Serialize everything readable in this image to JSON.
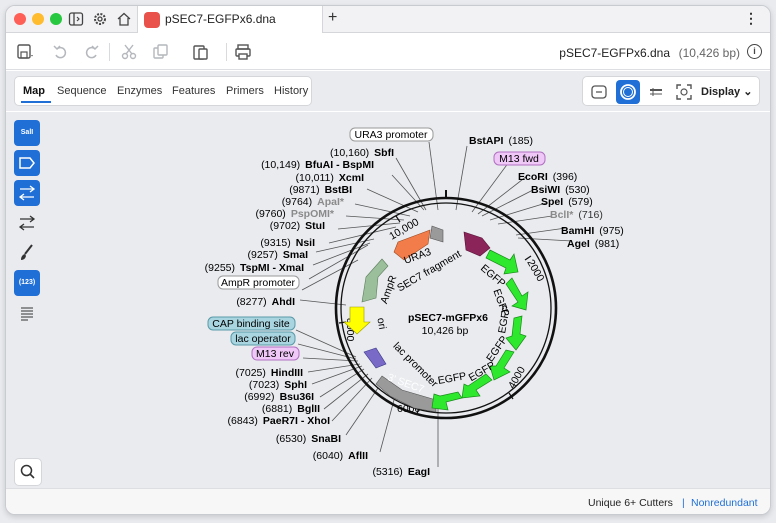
{
  "tab": {
    "title": "pSEC7-EGFPx6.dna"
  },
  "toolbar": {
    "file_name": "pSEC7-EGFPx6.dna",
    "file_length": "(10,426 bp)",
    "info_label": "i"
  },
  "view_tabs": [
    "Map",
    "Sequence",
    "Enzymes",
    "Features",
    "Primers",
    "History"
  ],
  "display_label": "Display",
  "left_tools": {
    "enzyme_label": "SalI",
    "numbers_label": "(123)"
  },
  "map": {
    "name": "pSEC7-mGFPx6",
    "length": "10,426 bp",
    "ticks": [
      "2000",
      "4000",
      "6000",
      "8000",
      "10,000"
    ],
    "features": [
      "URA3",
      "SEC7 fragment",
      "AmpR",
      "ori",
      "lac promoter",
      "3' SEC7",
      "EGFP",
      "EGFP",
      "EGFP",
      "EGFP",
      "EGFP",
      "EGFP"
    ]
  },
  "boxed_labels": {
    "ura3_promoter": "URA3 promoter",
    "m13_fwd": "M13 fwd",
    "ampr_promoter": "AmpR promoter",
    "cap_binding": "CAP binding site",
    "lac_operator": "lac operator",
    "m13_rev": "M13 rev"
  },
  "sites_right": [
    {
      "pos": "(185)",
      "name": "BstAPI"
    },
    {
      "pos": "(396)",
      "name": "EcoRI"
    },
    {
      "pos": "(530)",
      "name": "BsiWI"
    },
    {
      "pos": "(579)",
      "name": "SpeI"
    },
    {
      "pos": "(716)",
      "name": "BclI*"
    },
    {
      "pos": "(975)",
      "name": "BamHI"
    },
    {
      "pos": "(981)",
      "name": "AgeI"
    }
  ],
  "sites_left": [
    {
      "pos": "(10,160)",
      "name": "SbfI"
    },
    {
      "pos": "(10,149)",
      "name": "BfuAI - BspMI"
    },
    {
      "pos": "(10,011)",
      "name": "XcmI"
    },
    {
      "pos": "(9871)",
      "name": "BstBI"
    },
    {
      "pos": "(9764)",
      "name": "ApaI*"
    },
    {
      "pos": "(9760)",
      "name": "PspOMI*"
    },
    {
      "pos": "(9702)",
      "name": "StuI"
    },
    {
      "pos": "(9315)",
      "name": "NsiI"
    },
    {
      "pos": "(9257)",
      "name": "SmaI"
    },
    {
      "pos": "(9255)",
      "name": "TspMI - XmaI"
    },
    {
      "pos": "(8277)",
      "name": "AhdI"
    },
    {
      "pos": "(7025)",
      "name": "HindIII"
    },
    {
      "pos": "(7023)",
      "name": "SphI"
    },
    {
      "pos": "(6992)",
      "name": "Bsu36I"
    },
    {
      "pos": "(6881)",
      "name": "BglII"
    },
    {
      "pos": "(6843)",
      "name": "PaeR7I - XhoI"
    },
    {
      "pos": "(6530)",
      "name": "SnaBI"
    },
    {
      "pos": "(6040)",
      "name": "AflII"
    },
    {
      "pos": "(5316)",
      "name": "EagI"
    }
  ],
  "status": {
    "cutters": "Unique 6+ Cutters",
    "separator": "|",
    "mode": "Nonredundant"
  },
  "colors": {
    "accent": "#1f6fd6",
    "egfp": "#2ee82e",
    "ura3": "#f37d4a",
    "ampr": "#9bbf9b",
    "ori": "#ffff00",
    "sec7": "#999999",
    "m13": "#f0c8f8"
  }
}
